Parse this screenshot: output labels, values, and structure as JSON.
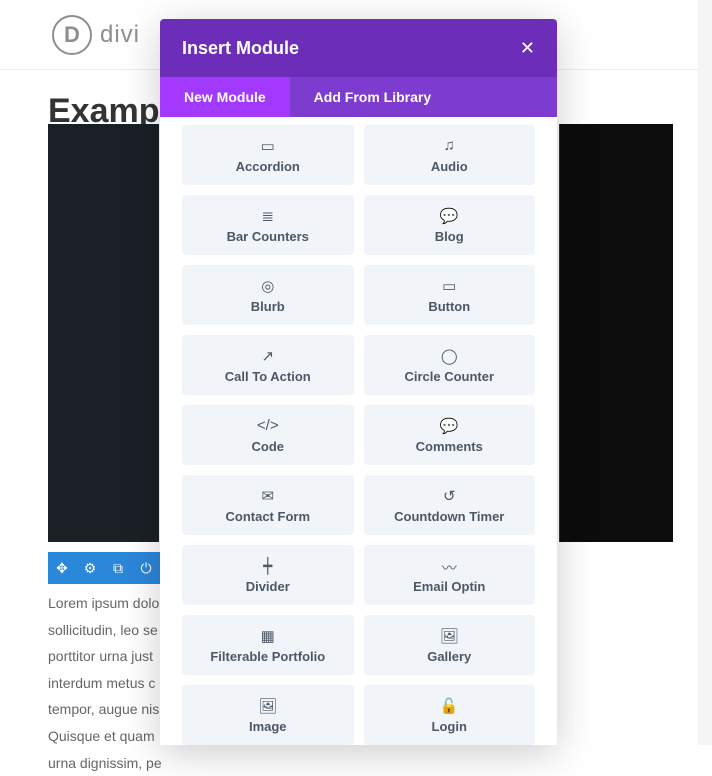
{
  "brand": {
    "mark": "D",
    "name": "divi"
  },
  "page": {
    "title": "Example"
  },
  "paragraph": "Lorem ipsum dolor sollicitudin, leo se porttitor urna just interdum metus c tempor, augue nis Quisque et quam urna dignissim, pe",
  "modal": {
    "title": "Insert Module",
    "tabs": [
      "New Module",
      "Add From Library"
    ],
    "active_tab": 0,
    "modules": [
      {
        "label": "Accordion",
        "icon": "▭"
      },
      {
        "label": "Audio",
        "icon": "♫"
      },
      {
        "label": "Bar Counters",
        "icon": "≣"
      },
      {
        "label": "Blog",
        "icon": "💬"
      },
      {
        "label": "Blurb",
        "icon": "◎"
      },
      {
        "label": "Button",
        "icon": "▭"
      },
      {
        "label": "Call To Action",
        "icon": "↗"
      },
      {
        "label": "Circle Counter",
        "icon": "◯"
      },
      {
        "label": "Code",
        "icon": "</>"
      },
      {
        "label": "Comments",
        "icon": "💬"
      },
      {
        "label": "Contact Form",
        "icon": "✉"
      },
      {
        "label": "Countdown Timer",
        "icon": "↺"
      },
      {
        "label": "Divider",
        "icon": "┿"
      },
      {
        "label": "Email Optin",
        "icon": "〰"
      },
      {
        "label": "Filterable Portfolio",
        "icon": "▦"
      },
      {
        "label": "Gallery",
        "icon": "🖼"
      },
      {
        "label": "Image",
        "icon": "🖼"
      },
      {
        "label": "Login",
        "icon": "🔓"
      }
    ]
  },
  "toolbar_icons": [
    "✥",
    "⚙",
    "⧉",
    "⏻"
  ]
}
